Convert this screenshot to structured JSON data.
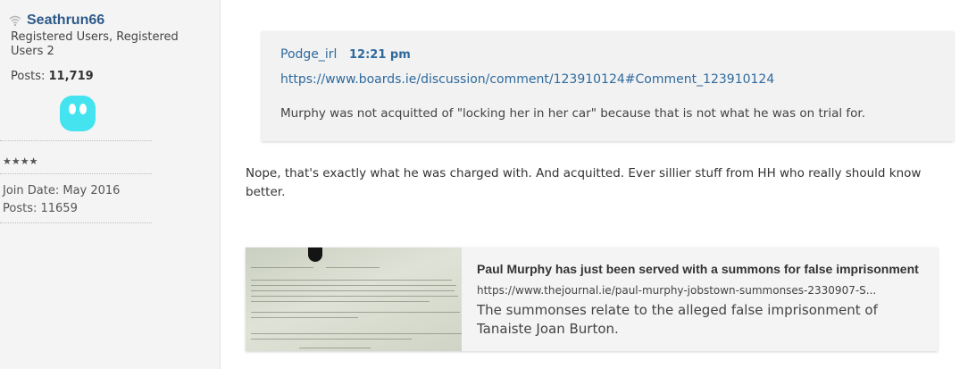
{
  "user": {
    "username": "Seathrun66",
    "roles": "Registered Users, Registered Users 2",
    "posts_label": "Posts:",
    "posts_count": "11,719",
    "stars": "★★★★",
    "join_date": "Join Date: May 2016",
    "posts_plain": "Posts: 11659",
    "avatar_color": "#43e3f0",
    "status_icon": "wifi-signal-icon"
  },
  "quote": {
    "author": "Podge_irl",
    "time": "12:21 pm",
    "link": "https://www.boards.ie/discussion/comment/123910124#Comment_123910124",
    "text": "Murphy was not acquitted of \"locking her in her car\" because that is not what he was on trial for."
  },
  "post": {
    "text": "Nope, that's exactly what he was charged with. And acquitted. Ever sillier stuff from HH who really should know better."
  },
  "embed": {
    "title": "Paul Murphy has just been served with a summons for false imprisonment",
    "url": "https://www.thejournal.ie/paul-murphy-jobstown-summonses-2330907-S...",
    "description": "The summonses relate to the alleged false imprisonment of Tanaiste Joan Burton."
  },
  "colors": {
    "link": "#2e6a9e",
    "username": "#2e5a8a"
  }
}
